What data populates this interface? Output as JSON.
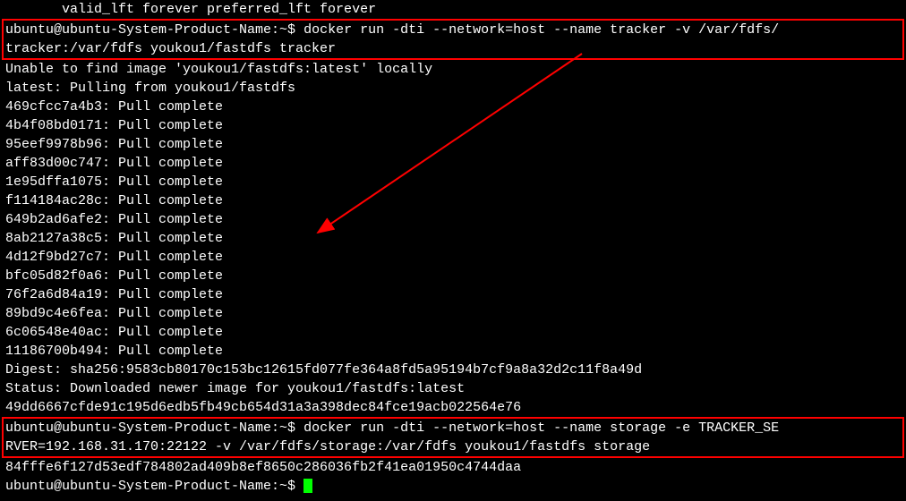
{
  "lines": {
    "top_fragment": "       valid_lft forever preferred_lft forever",
    "cmd1_prompt": "ubuntu@ubuntu-System-Product-Name:~$",
    "cmd1_a": " docker run -dti --network=host --name tracker -v /var/fdfs/",
    "cmd1_b": "tracker:/var/fdfs youkou1/fastdfs tracker",
    "unable": "Unable to find image 'youkou1/fastdfs:latest' locally",
    "latest": "latest: Pulling from youkou1/fastdfs",
    "pulls": [
      "469cfcc7a4b3: Pull complete",
      "4b4f08bd0171: Pull complete",
      "95eef9978b96: Pull complete",
      "aff83d00c747: Pull complete",
      "1e95dffa1075: Pull complete",
      "f114184ac28c: Pull complete",
      "649b2ad6afe2: Pull complete",
      "8ab2127a38c5: Pull complete",
      "4d12f9bd27c7: Pull complete",
      "bfc05d82f0a6: Pull complete",
      "76f2a6d84a19: Pull complete",
      "89bd9c4e6fea: Pull complete",
      "6c06548e40ac: Pull complete",
      "11186700b494: Pull complete"
    ],
    "digest": "Digest: sha256:9583cb80170c153bc12615fd077fe364a8fd5a95194b7cf9a8a32d2c11f8a49d",
    "status": "Status: Downloaded newer image for youkou1/fastdfs:latest",
    "sha_line": "49dd6667cfde91c195d6edb5fb49cb654d31a3a398dec84fce19acb022564e76",
    "cmd2_prompt": "ubuntu@ubuntu-System-Product-Name:~$",
    "cmd2_a": " docker run -dti --network=host --name storage -e TRACKER_SE",
    "cmd2_b": "RVER=192.168.31.170:22122 -v /var/fdfs/storage:/var/fdfs youkou1/fastdfs storage",
    "sha_out2": "84fffe6f127d53edf784802ad409b8ef8650c286036fb2f41ea01950c4744daa",
    "final_prompt": "ubuntu@ubuntu-System-Product-Name:~$ "
  },
  "colors": {
    "highlight_border": "#ff0000",
    "cursor": "#00ff00"
  }
}
